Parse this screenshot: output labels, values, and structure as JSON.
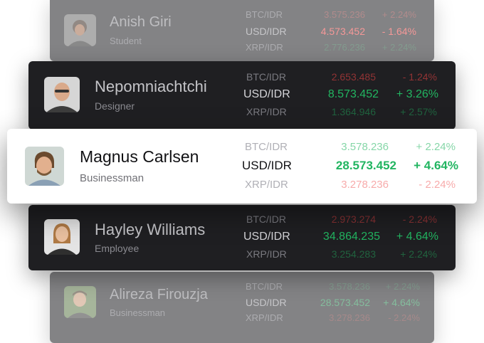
{
  "colors": {
    "green": "#22b561",
    "red": "#ef4444",
    "dark_card": "#1f1f22",
    "light_card": "#ffffff"
  },
  "cards": [
    {
      "name": "Anish Giri",
      "role": "Student",
      "avatar": "anish-giri-avatar",
      "rows": [
        {
          "pair": "BTC/IDR",
          "value": "3.575.236",
          "change": "+ 2.24%",
          "trend": "up"
        },
        {
          "pair": "USD/IDR",
          "value": "4.573.452",
          "change": "- 1.64%",
          "trend": "down"
        },
        {
          "pair": "XRP/IDR",
          "value": "2.776.236",
          "change": "+ 2.24%",
          "trend": "up"
        }
      ]
    },
    {
      "name": "Nepomniachtchi",
      "role": "Designer",
      "avatar": "nepomniachtchi-avatar",
      "rows": [
        {
          "pair": "BTC/IDR",
          "value": "2.653.485",
          "change": "- 1.24%",
          "trend": "down"
        },
        {
          "pair": "USD/IDR",
          "value": "8.573.452",
          "change": "+ 3.26%",
          "trend": "up"
        },
        {
          "pair": "XRP/IDR",
          "value": "1.364.946",
          "change": "+ 2.57%",
          "trend": "up"
        }
      ]
    },
    {
      "name": "Magnus Carlsen",
      "role": "Businessman",
      "avatar": "magnus-carlsen-avatar",
      "rows": [
        {
          "pair": "BTC/IDR",
          "value": "3.578.236",
          "change": "+ 2.24%",
          "trend": "up"
        },
        {
          "pair": "USD/IDR",
          "value": "28.573.452",
          "change": "+ 4.64%",
          "trend": "up"
        },
        {
          "pair": "XRP/IDR",
          "value": "3.278.236",
          "change": "- 2.24%",
          "trend": "down"
        }
      ]
    },
    {
      "name": "Hayley Williams",
      "role": "Employee",
      "avatar": "hayley-williams-avatar",
      "rows": [
        {
          "pair": "BTC/IDR",
          "value": "2.973.274",
          "change": "- 2.24%",
          "trend": "down"
        },
        {
          "pair": "USD/IDR",
          "value": "34.864.235",
          "change": "+ 4.64%",
          "trend": "up"
        },
        {
          "pair": "XRP/IDR",
          "value": "3.254.283",
          "change": "+ 2.24%",
          "trend": "up"
        }
      ]
    },
    {
      "name": "Alireza Firouzja",
      "role": "Businessman",
      "avatar": "alireza-firouzja-avatar",
      "rows": [
        {
          "pair": "BTC/IDR",
          "value": "3.578.236",
          "change": "+ 2.24%",
          "trend": "up"
        },
        {
          "pair": "USD/IDR",
          "value": "28.573.452",
          "change": "+ 4.64%",
          "trend": "up"
        },
        {
          "pair": "XRP/IDR",
          "value": "3.278.236",
          "change": "- 2.24%",
          "trend": "down"
        }
      ]
    }
  ]
}
